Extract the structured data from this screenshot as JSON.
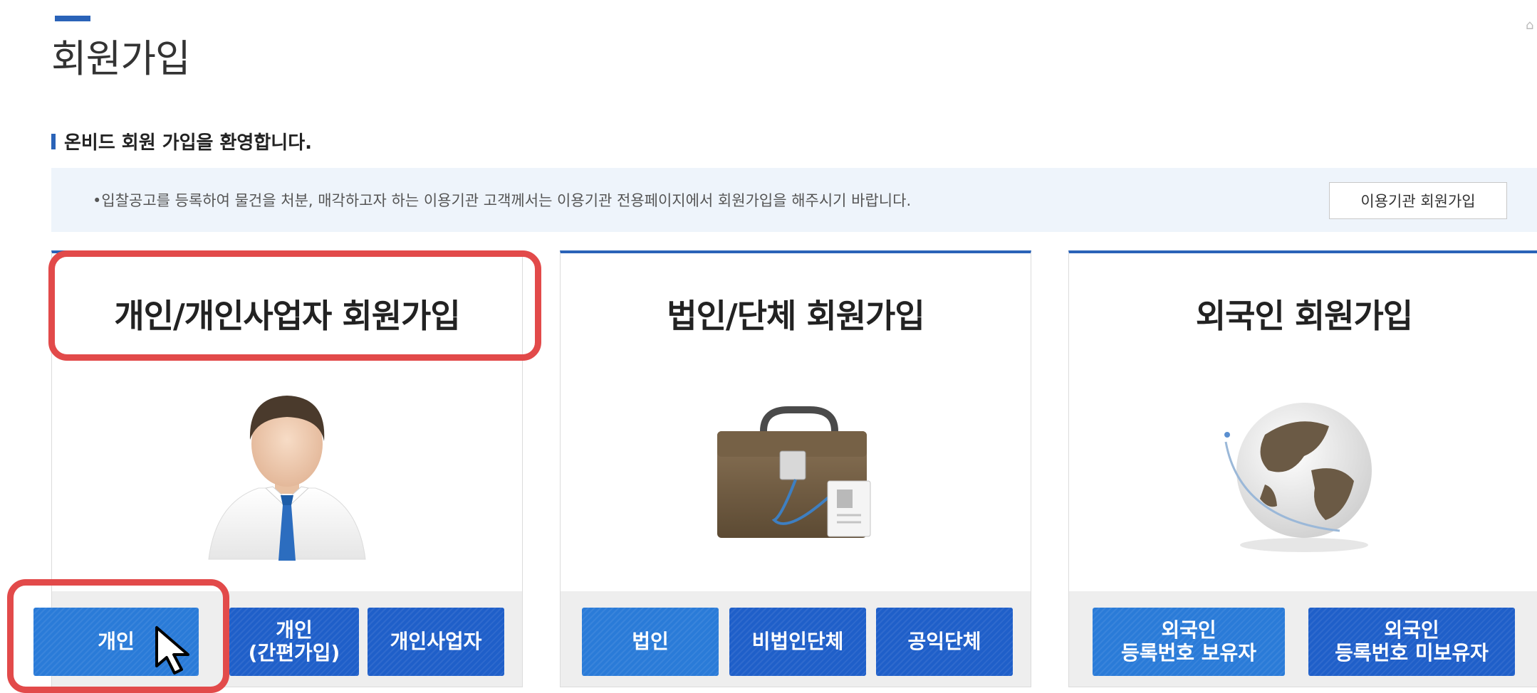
{
  "page": {
    "title": "회원가입"
  },
  "section": {
    "heading": "온비드 회원 가입을 환영합니다."
  },
  "notice": {
    "text": "•입찰공고를 등록하여 물건을 처분, 매각하고자 하는 이용기관 고객께서는 이용기관 전용페이지에서 회원가입을 해주시기 바랍니다.",
    "button_label": "이용기관 회원가입"
  },
  "cards": [
    {
      "title": "개인/개인사업자 회원가입",
      "illustration": "businessman-icon",
      "buttons": [
        "개인",
        "개인\n(간편가입)",
        "개인사업자"
      ]
    },
    {
      "title": "법인/단체 회원가입",
      "illustration": "briefcase-icon",
      "buttons": [
        "법인",
        "비법인단체",
        "공익단체"
      ]
    },
    {
      "title": "외국인 회원가입",
      "illustration": "globe-icon",
      "buttons": [
        "외국인\n등록번호 보유자",
        "외국인\n등록번호 미보유자"
      ]
    }
  ],
  "colors": {
    "accent": "#2a63b8",
    "button": "#1f5fc9",
    "highlight": "#e24a4a",
    "notice_bg": "#eef4fb"
  }
}
